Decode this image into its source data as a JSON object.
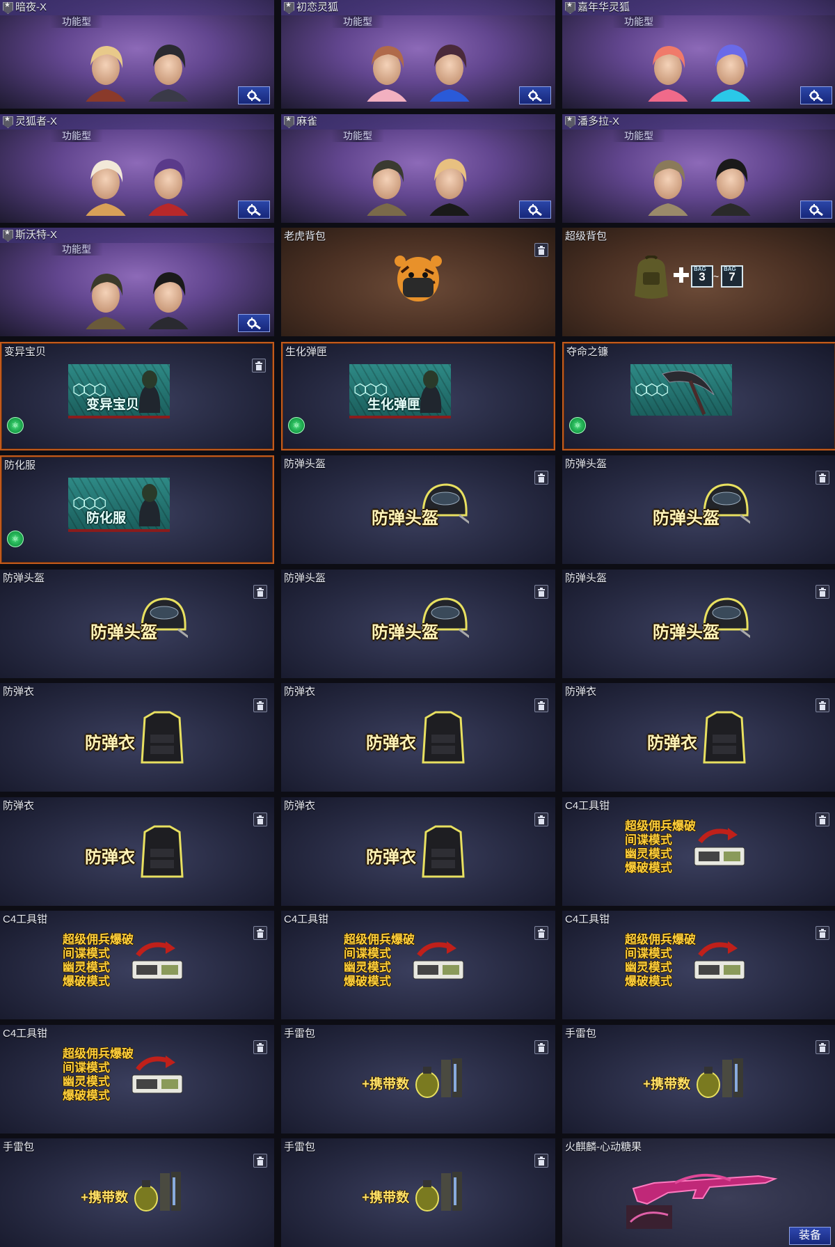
{
  "labels": {
    "functional": "功能型",
    "plus_carry": "+携带数",
    "equip": "装备",
    "bag_word": "BAG",
    "bag_min": "3",
    "bag_max": "7",
    "bag_tilde": "~",
    "c4_modes": [
      "超级佣兵爆破",
      "间谍模式",
      "幽灵模式",
      "爆破模式"
    ]
  },
  "icons": {
    "rank": "rank-star-icon",
    "settings": "gear-wrench-icon",
    "trash": "trash-icon",
    "nano": "nano-bio-icon"
  },
  "colors": {
    "highlight_border": "#c25a1c",
    "button_blue": "#2b46a8",
    "label_gold": "#ffd23a"
  },
  "cards": [
    {
      "title": "暗夜-X",
      "kind": "character",
      "rank": true,
      "functional": true,
      "settings": true
    },
    {
      "title": "初恋灵狐",
      "kind": "character",
      "rank": true,
      "functional": true,
      "settings": true
    },
    {
      "title": "嘉年华灵狐",
      "kind": "character",
      "rank": true,
      "functional": true,
      "settings": true
    },
    {
      "title": "灵狐者-X",
      "kind": "character",
      "rank": true,
      "functional": true,
      "settings": true
    },
    {
      "title": "麻雀",
      "kind": "character",
      "rank": true,
      "functional": true,
      "settings": true
    },
    {
      "title": "潘多拉-X",
      "kind": "character",
      "rank": true,
      "functional": true,
      "settings": true
    },
    {
      "title": "斯沃特-X",
      "kind": "character",
      "rank": true,
      "functional": true,
      "settings": true
    },
    {
      "title": "老虎背包",
      "kind": "tiger-bag",
      "trash": true
    },
    {
      "title": "超级背包",
      "kind": "super-bag"
    },
    {
      "title": "变异宝贝",
      "kind": "bio",
      "art_label": "变异宝贝",
      "trash": true,
      "orange": true,
      "nano": true
    },
    {
      "title": "生化弹匣",
      "kind": "bio",
      "art_label": "生化弹匣",
      "orange": true,
      "nano": true
    },
    {
      "title": "夺命之镰",
      "kind": "bio-scythe",
      "orange": true,
      "nano": true
    },
    {
      "title": "防化服",
      "kind": "bio",
      "art_label": "防化服",
      "orange": true,
      "nano": true
    },
    {
      "title": "防弹头盔",
      "kind": "helmet",
      "art_label": "防弹头盔",
      "trash": true
    },
    {
      "title": "防弹头盔",
      "kind": "helmet",
      "art_label": "防弹头盔",
      "trash": true
    },
    {
      "title": "防弹头盔",
      "kind": "helmet",
      "art_label": "防弹头盔",
      "trash": true
    },
    {
      "title": "防弹头盔",
      "kind": "helmet",
      "art_label": "防弹头盔",
      "trash": true
    },
    {
      "title": "防弹头盔",
      "kind": "helmet",
      "art_label": "防弹头盔",
      "trash": true
    },
    {
      "title": "防弹衣",
      "kind": "vest",
      "art_label": "防弹衣",
      "trash": true
    },
    {
      "title": "防弹衣",
      "kind": "vest",
      "art_label": "防弹衣",
      "trash": true
    },
    {
      "title": "防弹衣",
      "kind": "vest",
      "art_label": "防弹衣",
      "trash": true
    },
    {
      "title": "防弹衣",
      "kind": "vest",
      "art_label": "防弹衣",
      "trash": true
    },
    {
      "title": "防弹衣",
      "kind": "vest",
      "art_label": "防弹衣",
      "trash": true
    },
    {
      "title": "C4工具钳",
      "kind": "c4",
      "trash": true
    },
    {
      "title": "C4工具钳",
      "kind": "c4",
      "trash": true
    },
    {
      "title": "C4工具钳",
      "kind": "c4",
      "trash": true
    },
    {
      "title": "C4工具钳",
      "kind": "c4",
      "trash": true
    },
    {
      "title": "C4工具钳",
      "kind": "c4",
      "trash": true
    },
    {
      "title": "手雷包",
      "kind": "grenade",
      "trash": true
    },
    {
      "title": "手雷包",
      "kind": "grenade",
      "trash": true
    },
    {
      "title": "手雷包",
      "kind": "grenade",
      "trash": true
    },
    {
      "title": "手雷包",
      "kind": "grenade",
      "trash": true
    },
    {
      "title": "火麒麟-心动糖果",
      "kind": "weapon",
      "equip": true
    }
  ]
}
